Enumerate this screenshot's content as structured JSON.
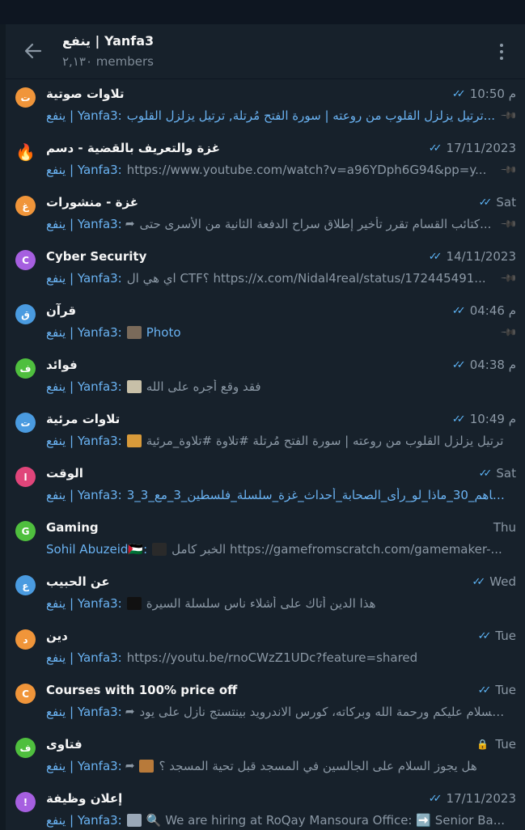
{
  "header": {
    "title": "ينفع | Yanfa3",
    "subtitle": "٢,١٣٠ members"
  },
  "colors": {
    "accent": "#5eb5f7",
    "link": "#6ab3f3",
    "background": "#17212b"
  },
  "rows": [
    {
      "name": "تلاوات صوتية",
      "avatar": "ت",
      "avatar_color": "#f0953a",
      "time": "م 10:50",
      "ticks": "✓✓",
      "sender": "ينفع | Yanfa3:",
      "message": "ترتيل يزلزل القلوب من روعته | سورة الفتح مُرتلة, ترتيل يزلزل القلوب...",
      "message_color": "blue",
      "pinned": true
    },
    {
      "name": "غزة والتعريف بالقضية - دسم",
      "avatar": "🔥",
      "avatar_color": "transparent",
      "time": "17/11/2023",
      "ticks": "✓✓",
      "sender": "ينفع | Yanfa3:",
      "message": "https://www.youtube.com/watch?v=a96YDph6G94&pp=y...",
      "message_color": "gray",
      "pinned": true
    },
    {
      "name": "غزة - منشورات",
      "avatar": "غ",
      "avatar_color": "#f0953a",
      "time": "Sat",
      "ticks": "✓✓",
      "sender": "ينفع | Yanfa3:",
      "forwarded": true,
      "message": "كتائب القسام تقرر تأخير إطلاق سراح الدفعة الثانية من الأسرى حتى...",
      "message_color": "gray",
      "pinned": true
    },
    {
      "name": "Cyber Security",
      "avatar": "C",
      "avatar_color": "#a65fe0",
      "time": "14/11/2023",
      "ticks": "✓✓",
      "sender": "ينفع | Yanfa3:",
      "message": "اي هي ال CTF؟ https://x.com/Nidal4real/status/172445491...",
      "message_color": "gray",
      "pinned": true
    },
    {
      "name": "قرآن",
      "avatar": "ق",
      "avatar_color": "#4a9be0",
      "time": "م 04:46",
      "ticks": "✓✓",
      "sender": "ينفع | Yanfa3:",
      "thumb": "#7a6a5a",
      "message": "Photo",
      "message_color": "blue",
      "pinned": true
    },
    {
      "name": "فوائد",
      "avatar": "ف",
      "avatar_color": "#4fbf3e",
      "time": "م 04:38",
      "ticks": "✓✓",
      "sender": "ينفع | Yanfa3:",
      "thumb": "#c8c0a8",
      "message": "فقد وقع أجره على الله",
      "message_color": "gray",
      "pinned": false
    },
    {
      "name": "تلاوات مرئية",
      "avatar": "ت",
      "avatar_color": "#4a9be0",
      "time": "م 10:49",
      "ticks": "✓✓",
      "sender": "ينفع | Yanfa3:",
      "thumb": "#d89a3a",
      "message": "ترتيل يزلزل القلوب من روعته | سورة الفتح مُرتلة  #تلاوة #تلاوة_مرئية",
      "message_color": "gray",
      "pinned": false
    },
    {
      "name": "الوقت",
      "avatar": "ا",
      "avatar_color": "#e0457a",
      "time": "Sat",
      "ticks": "✓✓",
      "sender": "ينفع | Yanfa3:",
      "message": "3_مع_3_فاهم_30_ماذا_لو_رأى_الصحابة_أحداث_غزة_سلسلة_فلسطين_3_مع_3gX4...",
      "message_color": "blue",
      "pinned": false
    },
    {
      "name": "Gaming",
      "avatar": "G",
      "avatar_color": "#4fbf3e",
      "time": "Thu",
      "ticks": "",
      "sender": "Sohil Abuzeid🇵🇸:",
      "thumb": "#2a2a2a",
      "message": "الخبر كامل  https://gamefromscratch.com/gamemaker-...",
      "message_color": "gray",
      "pinned": false
    },
    {
      "name": "عن الحبيب",
      "avatar": "ع",
      "avatar_color": "#4a9be0",
      "time": "Wed",
      "ticks": "✓✓",
      "sender": "ينفع | Yanfa3:",
      "thumb": "#111111",
      "message": "هذا الدين أتاك على أشلاء ناس  سلسلة السيرة",
      "message_color": "gray",
      "pinned": false
    },
    {
      "name": "دين",
      "avatar": "د",
      "avatar_color": "#f0953a",
      "time": "Tue",
      "ticks": "✓✓",
      "sender": "ينفع | Yanfa3:",
      "message": "https://youtu.be/rnoCWzZ1UDc?feature=shared",
      "message_color": "gray",
      "pinned": false
    },
    {
      "name": "Courses with 100% price off",
      "avatar": "C",
      "avatar_color": "#f0953a",
      "time": "Tue",
      "ticks": "✓✓",
      "sender": "ينفع | Yanfa3:",
      "forwarded": true,
      "message": "السلام عليكم ورحمة الله وبركاته، كورس الاندرويد بينتستج نازل على يود...",
      "message_color": "gray",
      "pinned": false
    },
    {
      "name": "فتاوى",
      "avatar": "ف",
      "avatar_color": "#4fbf3e",
      "time": "Tue",
      "ticks": "",
      "locked": true,
      "sender": "ينفع | Yanfa3:",
      "forwarded": true,
      "thumb": "#b87a3a",
      "message": "هل يجوز السلام على الجالسين في المسجد قبل تحية المسجد ؟",
      "message_color": "gray",
      "pinned": false
    },
    {
      "name": "إعلان وظيفة",
      "avatar": "!",
      "avatar_color": "#a65fe0",
      "time": "17/11/2023",
      "ticks": "✓✓",
      "sender": "ينفع | Yanfa3:",
      "thumb": "#9aa8b8",
      "message": "🔍 We are hiring at RoQay Mansoura Office: ➡️ Senior Ba...",
      "message_color": "gray",
      "pinned": false
    }
  ]
}
